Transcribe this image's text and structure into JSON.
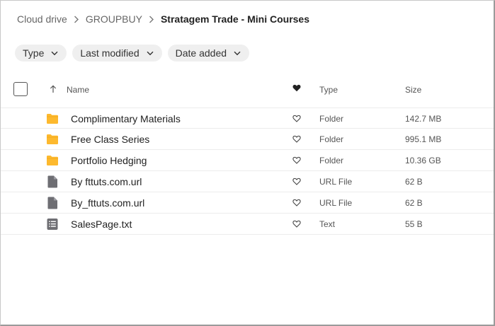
{
  "breadcrumb": [
    {
      "label": "Cloud drive"
    },
    {
      "label": "GROUPBUY"
    },
    {
      "label": "Stratagem Trade - Mini Courses"
    }
  ],
  "filters": [
    {
      "label": "Type"
    },
    {
      "label": "Last modified"
    },
    {
      "label": "Date added"
    }
  ],
  "columns": {
    "name": "Name",
    "type": "Type",
    "size": "Size"
  },
  "files": [
    {
      "name": "Complimentary Materials",
      "type": "Folder",
      "size": "142.7 MB",
      "icon": "folder-icon"
    },
    {
      "name": "Free Class Series",
      "type": "Folder",
      "size": "995.1 MB",
      "icon": "folder-icon"
    },
    {
      "name": "Portfolio Hedging",
      "type": "Folder",
      "size": "10.36 GB",
      "icon": "folder-icon"
    },
    {
      "name": "By fttuts.com.url",
      "type": "URL File",
      "size": "62 B",
      "icon": "url-file-icon"
    },
    {
      "name": "By_fttuts.com.url",
      "type": "URL File",
      "size": "62 B",
      "icon": "url-file-icon"
    },
    {
      "name": "SalesPage.txt",
      "type": "Text",
      "size": "55 B",
      "icon": "text-file-icon"
    }
  ],
  "colors": {
    "folder": "#FDB92E",
    "file": "#6E6E73",
    "text_file": "#6E6E73"
  }
}
